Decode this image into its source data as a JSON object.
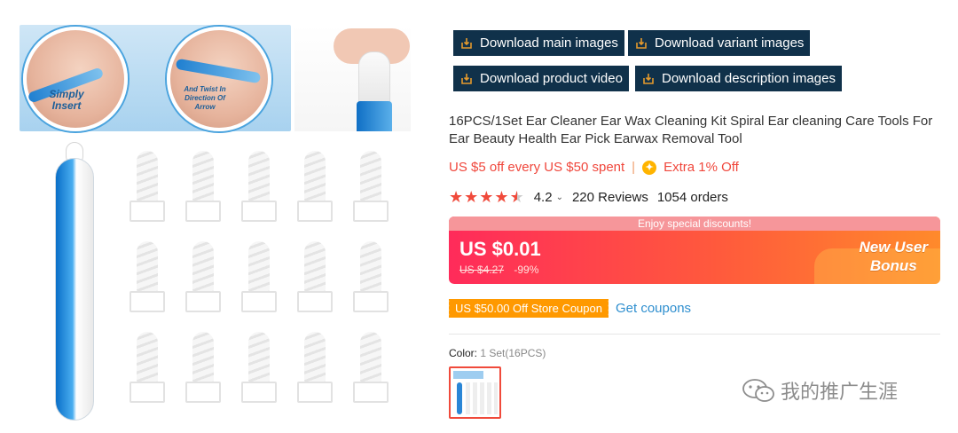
{
  "image": {
    "callout_simply_insert": "Simply Insert",
    "callout_twist": "And Twist In Direction Of Arrow"
  },
  "downloads": {
    "main_images": "Download main images",
    "variant_images": "Download variant images",
    "product_video": "Download product video",
    "description_images": "Download description images"
  },
  "product": {
    "title": "16PCS/1Set Ear Cleaner Ear Wax Cleaning Kit Spiral Ear cleaning Care Tools For Ear Beauty Health Ear Pick Earwax Removal Tool"
  },
  "promo": {
    "store_discount": "US $5 off every US $50 spent",
    "separator": "|",
    "extra_off": "Extra 1% Off",
    "coin_symbol": "✦"
  },
  "rating": {
    "value": "4.2",
    "stars": 4.5,
    "reviews": "220 Reviews",
    "orders": "1054 orders"
  },
  "price": {
    "strip": "Enjoy special discounts!",
    "current": "US $0.01",
    "original": "US $4.27",
    "discount": "-99%",
    "bonus_line1": "New User",
    "bonus_line2": "Bonus"
  },
  "coupon": {
    "tag": "US $50.00 Off Store Coupon",
    "link": "Get coupons"
  },
  "variant": {
    "label": "Color:",
    "value": "1 Set(16PCS)"
  },
  "watermark": {
    "text": "我的推广生涯"
  },
  "colors": {
    "button_bg": "#10314a",
    "price_red": "#f04a3b",
    "coupon_orange": "#ff9900",
    "link_blue": "#2f8fcf"
  }
}
